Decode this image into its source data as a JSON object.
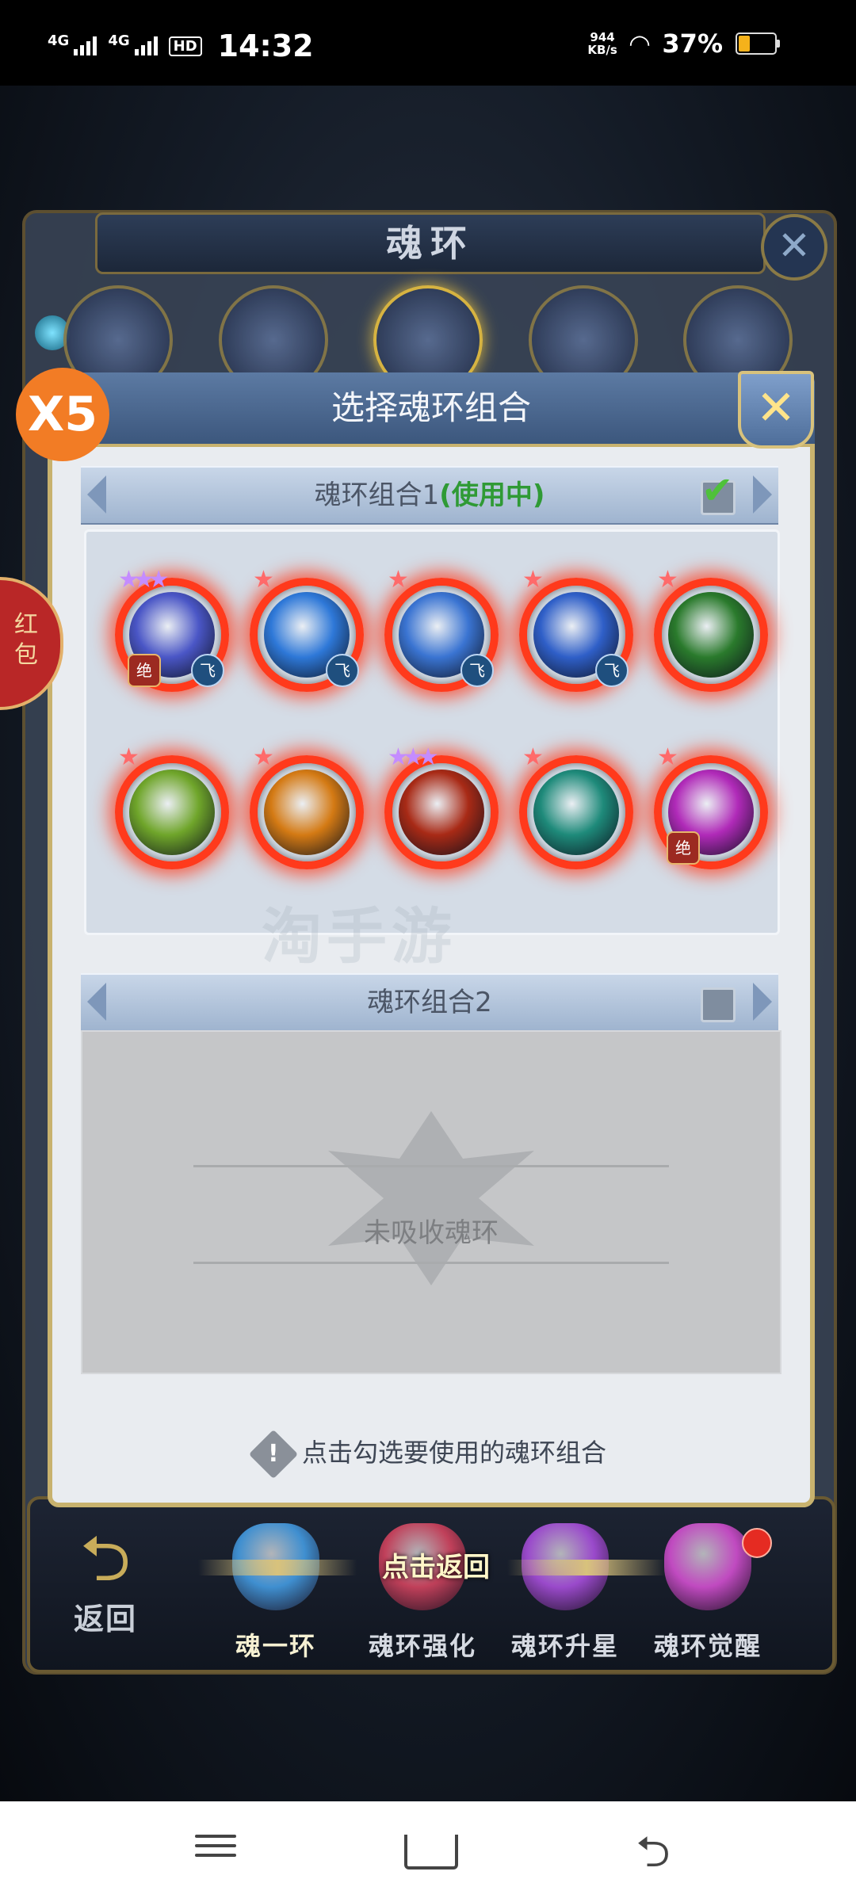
{
  "status_bar": {
    "signal1": "4G",
    "signal2": "4G",
    "hd": "HD",
    "time": "14:32",
    "net_speed_value": "944",
    "net_speed_unit": "KB/s",
    "battery": "37%"
  },
  "background": {
    "outer_title": "魂环",
    "outer_close": "✕"
  },
  "badges": {
    "x5": "X5",
    "red_packet": "红包"
  },
  "modal": {
    "title": "选择魂环组合",
    "close": "✕",
    "group1": {
      "label": "魂环组合1",
      "status": "(使用中)",
      "checked": true
    },
    "group2": {
      "label": "魂环组合2",
      "checked": false
    },
    "empty_text": "未吸收魂环",
    "hint": "点击勾选要使用的魂环组合",
    "watermark": "淘手游"
  },
  "rings": [
    {
      "stars": "★★★",
      "star_color": "purple",
      "core": "#4a56c6",
      "badge_left": "绝",
      "badge_right": "飞"
    },
    {
      "stars": "★",
      "star_color": "red",
      "core": "#2e78d8",
      "badge_left": "",
      "badge_right": "飞"
    },
    {
      "stars": "★",
      "star_color": "red",
      "core": "#3a74d2",
      "badge_left": "",
      "badge_right": "飞"
    },
    {
      "stars": "★",
      "star_color": "red",
      "core": "#2f5fc8",
      "badge_left": "",
      "badge_right": "飞"
    },
    {
      "stars": "★",
      "star_color": "red",
      "core": "#2a7a2c",
      "badge_left": "",
      "badge_right": ""
    },
    {
      "stars": "★",
      "star_color": "red",
      "core": "#6fa52a",
      "badge_left": "",
      "badge_right": ""
    },
    {
      "stars": "★",
      "star_color": "red",
      "core": "#d47a14",
      "badge_left": "",
      "badge_right": ""
    },
    {
      "stars": "★★★",
      "star_color": "purple",
      "core": "#a82a16",
      "badge_left": "",
      "badge_right": ""
    },
    {
      "stars": "★",
      "star_color": "red",
      "core": "#1e8a7a",
      "badge_left": "",
      "badge_right": ""
    },
    {
      "stars": "★",
      "star_color": "red",
      "core": "#b02ab8",
      "badge_left": "绝",
      "badge_right": ""
    }
  ],
  "bottom_nav": {
    "back": "返回",
    "return_tip": "点击返回",
    "tabs": [
      {
        "label": "魂一环",
        "gem": "#3f8fd0",
        "active": true
      },
      {
        "label": "魂环强化",
        "gem": "#c0405a",
        "active": false
      },
      {
        "label": "魂环升星",
        "gem": "#9a4acb",
        "active": false
      },
      {
        "label": "魂环觉醒",
        "gem": "#c04ac0",
        "active": false
      }
    ]
  }
}
